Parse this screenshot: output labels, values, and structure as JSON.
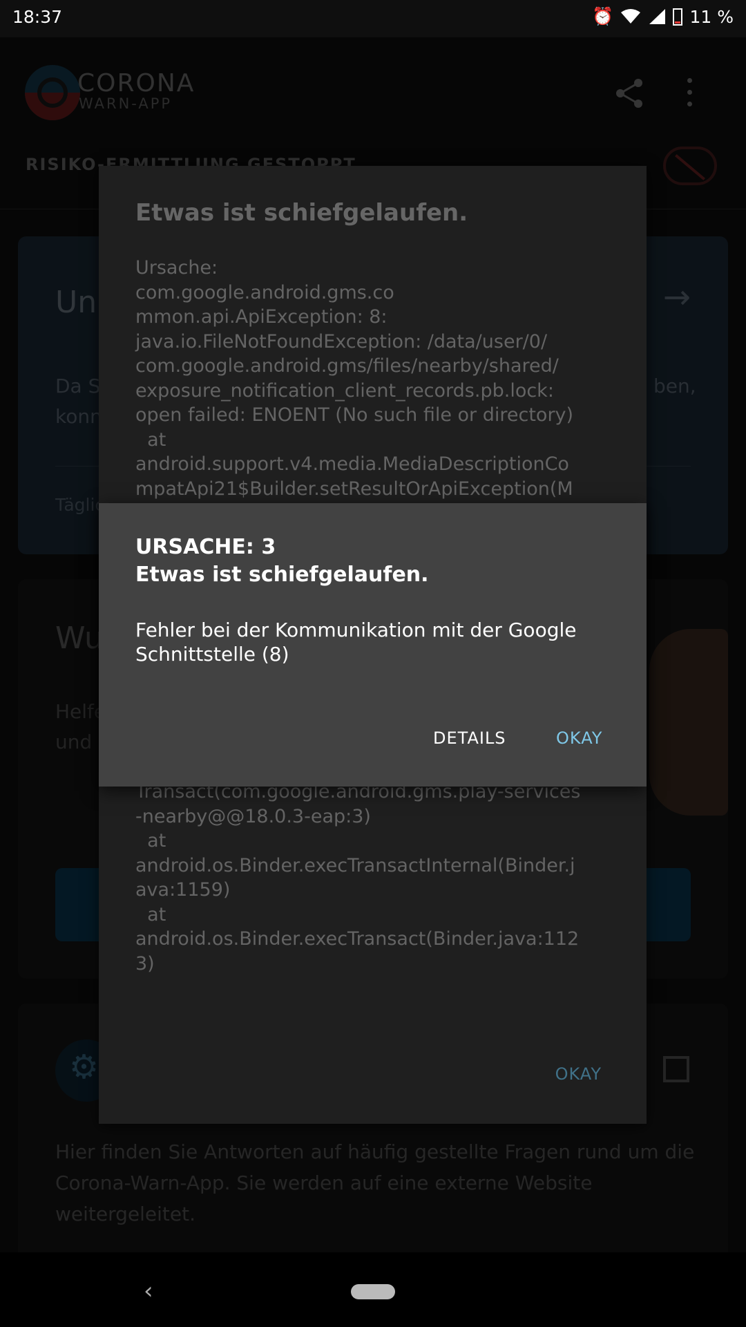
{
  "status_bar": {
    "time": "18:37",
    "battery": "11 %"
  },
  "app_bar": {
    "brand_line1": "CORONA",
    "brand_line2": "WARN-APP"
  },
  "subtitle": "RISIKO-ERMITTLUNG GESTOPPT",
  "risk_card": {
    "title_visible": "Unb",
    "text_visible_left": "Da S\nkonn",
    "text_visible_right": "ben,",
    "footer_visible": "Täglic"
  },
  "share_card": {
    "title_visible": "Wu",
    "text_visible": "Helfe\nund"
  },
  "faq_card": {
    "text": "Hier finden Sie Antworten auf häufig gestellte Fragen rund um die Corona-Warn-App. Sie werden auf eine externe Website weitergeleitet."
  },
  "error_dialog": {
    "title": "Etwas ist schiefgelaufen.",
    "body_top": "Ursache:\ncom.google.android.gms.co\nmmon.api.ApiException: 8:\njava.io.FileNotFoundException: /data/user/0/\ncom.google.android.gms/files/nearby/shared/\nexposure_notification_client_records.pb.lock:\nopen failed: ENOENT (No such file or directory)\n  at\nandroid.support.v4.media.MediaDescriptionCo\nmpatApi21$Builder.setResultOrApiException(M",
    "body_bottom": "Transact(com.google.android.gms.play-services\n-nearby@@18.0.3-eap:3)\n  at\nandroid.os.Binder.execTransactInternal(Binder.j\nava:1159)\n  at\nandroid.os.Binder.execTransact(Binder.java:112\n3)",
    "ok_label": "OKAY"
  },
  "cause_dialog": {
    "title_line1": "URSACHE: 3",
    "title_line2": "Etwas ist schiefgelaufen.",
    "message": "Fehler bei der Kommunikation mit der Google Schnittstelle (8)",
    "details_label": "DETAILS",
    "ok_label": "OKAY"
  },
  "colors": {
    "accent": "#7fc8e8",
    "dialog_bg": "#424242",
    "back_dialog_bg": "#262626"
  }
}
